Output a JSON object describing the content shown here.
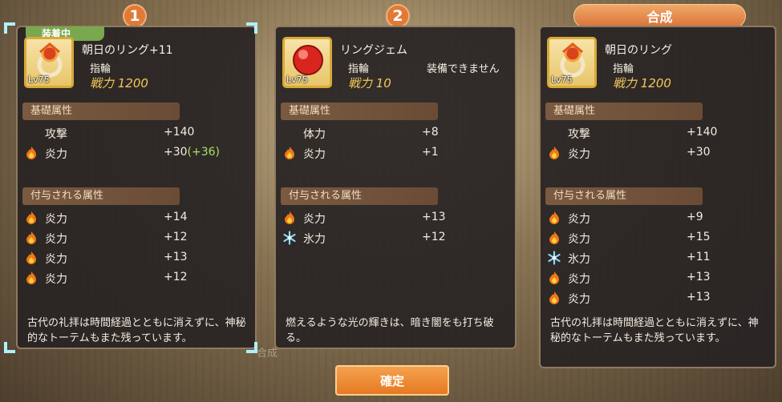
{
  "badges": {
    "one": "1",
    "two": "2",
    "synth_tab": "合成"
  },
  "colors": {
    "accent": "#e07a35",
    "power": "#f3c85a",
    "bonus": "#a8e067",
    "equipped": "#79a84f"
  },
  "panel1": {
    "equipped_label": "装着中",
    "name": "朝日のリング+11",
    "type": "指輪",
    "level": "Lv75",
    "power": "戦力 1200",
    "base_header": "基礎属性",
    "base": [
      {
        "name": "攻撃",
        "icon": "",
        "value": "+140",
        "bonus": ""
      },
      {
        "name": "炎力",
        "icon": "fire-icon",
        "value": "+30",
        "bonus": "(+36)"
      }
    ],
    "extra_header": "付与される属性",
    "extra": [
      {
        "name": "炎力",
        "icon": "fire-icon",
        "value": "+14"
      },
      {
        "name": "炎力",
        "icon": "fire-icon",
        "value": "+12"
      },
      {
        "name": "炎力",
        "icon": "fire-icon",
        "value": "+13"
      },
      {
        "name": "炎力",
        "icon": "fire-icon",
        "value": "+12"
      }
    ],
    "desc": "古代の礼拝は時間経過とともに消えずに、神秘的なトーテムもまた残っています。"
  },
  "panel2": {
    "name": "リングジェム",
    "type": "指輪",
    "note": "装備できません",
    "level": "Lv75",
    "power": "戦力 10",
    "base_header": "基礎属性",
    "base": [
      {
        "name": "体力",
        "icon": "",
        "value": "+8"
      },
      {
        "name": "炎力",
        "icon": "fire-icon",
        "value": "+1"
      }
    ],
    "extra_header": "付与される属性",
    "extra": [
      {
        "name": "炎力",
        "icon": "fire-icon",
        "value": "+13"
      },
      {
        "name": "氷力",
        "icon": "ice-icon",
        "value": "+12"
      }
    ],
    "desc": "燃えるような光の輝きは、暗き闇をも打ち破る。"
  },
  "panel3": {
    "name": "朝日のリング",
    "type": "指輪",
    "level": "Lv75",
    "power": "戦力 1200",
    "base_header": "基礎属性",
    "base": [
      {
        "name": "攻撃",
        "icon": "",
        "value": "+140"
      },
      {
        "name": "炎力",
        "icon": "fire-icon",
        "value": "+30"
      }
    ],
    "extra_header": "付与される属性",
    "extra": [
      {
        "name": "炎力",
        "icon": "fire-icon",
        "value": "+9"
      },
      {
        "name": "炎力",
        "icon": "fire-icon",
        "value": "+15"
      },
      {
        "name": "氷力",
        "icon": "ice-icon",
        "value": "+11"
      },
      {
        "name": "炎力",
        "icon": "fire-icon",
        "value": "+13"
      },
      {
        "name": "炎力",
        "icon": "fire-icon",
        "value": "+13"
      }
    ],
    "desc": "古代の礼拝は時間経過とともに消えずに、神秘的なトーテムもまた残っています。"
  },
  "confirm_label": "確定",
  "ghost_label": "合成"
}
